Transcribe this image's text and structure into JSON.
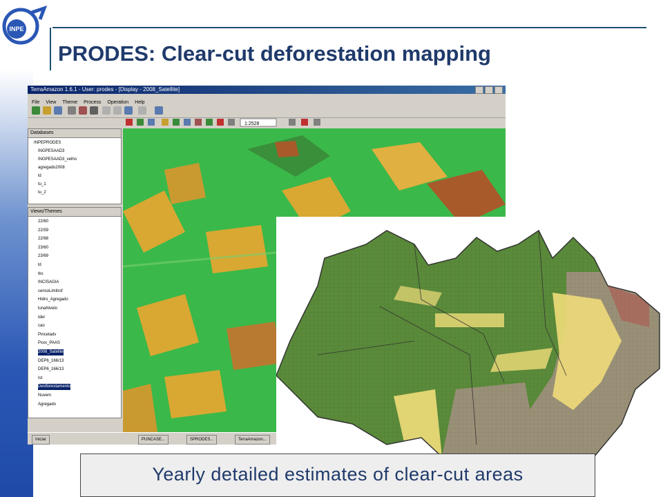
{
  "slide": {
    "title": "PRODES: Clear-cut deforestation mapping",
    "caption": "Yearly detailed estimates of clear-cut areas",
    "logo_text": "INPE"
  },
  "app": {
    "window_title": "TerraAmazon 1.6.1 - User: prodes - [Display - 2008_Satellite]",
    "menu": [
      "File",
      "View",
      "Theme",
      "Process",
      "Operation",
      "Help"
    ],
    "scale_value": "1:2528",
    "databases_header": "Databases",
    "database_tree": [
      "INPEPRODES",
      "INGPESAAD3",
      "INGPESAAD3_velho",
      "agregado2008",
      "ld",
      "tu_1",
      "tu_2"
    ],
    "views_header": "Views/Themes",
    "views_tree": [
      "22/60",
      "22/59",
      "22/68",
      "23/60",
      "23/69",
      "ld",
      "tks",
      "INCISAGIA",
      "censoLimitrof",
      "Hidro_Agregado",
      "lunaNivelo",
      "Ider",
      "cao",
      "Pincetadv",
      "Pxxx_PAAS",
      "2008_Satelite",
      "DEP6_166/13",
      "DEP6_166/13",
      "Ist",
      "Desflorestamento",
      "Nuvem",
      "Agregado"
    ],
    "selected_view_items": [
      15,
      19
    ],
    "taskbar": [
      "Iniciar",
      "PUNCASE...",
      "SPRODES...",
      "TerraAmazon..."
    ]
  },
  "colors": {
    "accent": "#1f3a6b",
    "forest": "#3bb84a",
    "map_forest": "#5a8a3a",
    "deforest": "#f0dc7a",
    "non_forest": "#9a9078"
  }
}
